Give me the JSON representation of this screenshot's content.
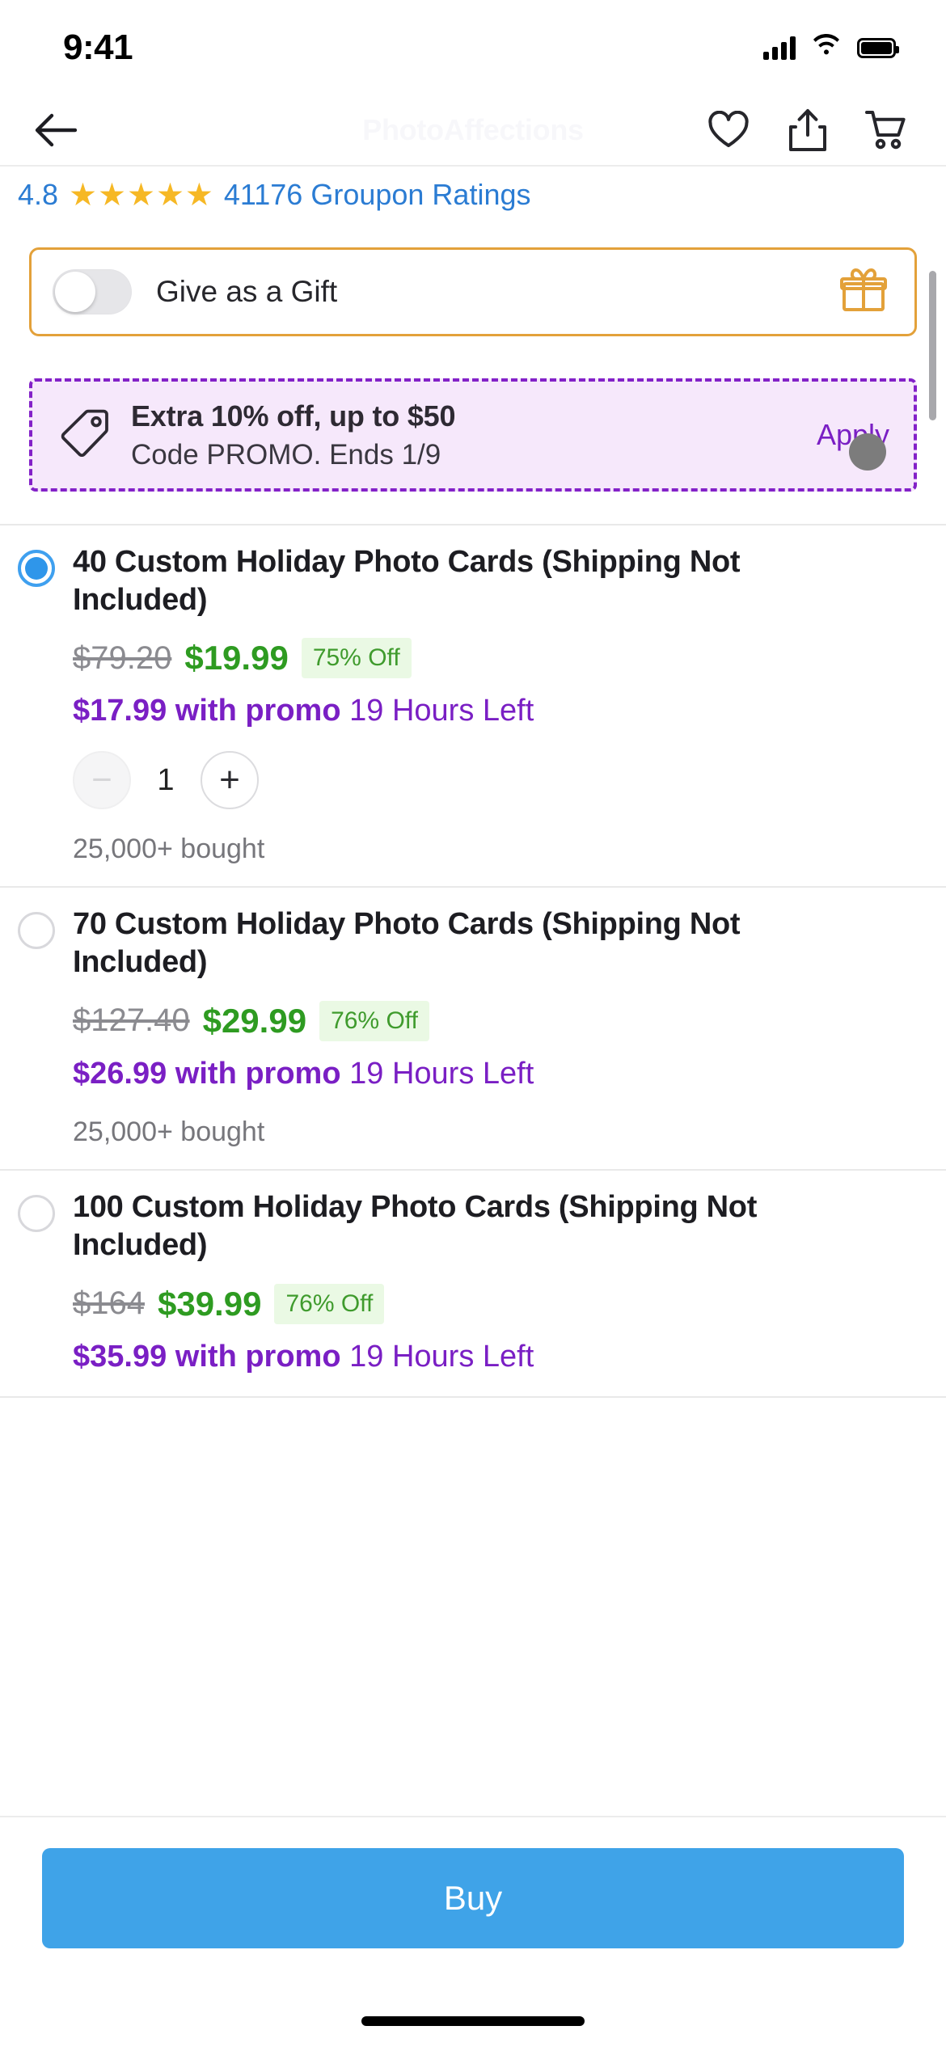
{
  "status_bar": {
    "time": "9:41",
    "signal_icon": "cellular-signal-icon",
    "wifi_icon": "wifi-icon",
    "battery_icon": "battery-icon"
  },
  "header": {
    "back_icon": "back-arrow-icon",
    "merchant_title": "PhotoAffections",
    "wishlist_icon": "heart-icon",
    "share_icon": "share-icon",
    "cart_icon": "cart-icon"
  },
  "ratings": {
    "score": "4.8",
    "stars": 5,
    "star_glyph": "★",
    "count_label": "41176 Groupon Ratings",
    "link_color": "#2b7cd3",
    "star_color": "#f6b825"
  },
  "gift": {
    "label": "Give as a Gift",
    "toggle_on": false,
    "gift_icon": "gift-box-icon",
    "border_color": "#e3a13a"
  },
  "promo": {
    "tag_icon": "price-tag-icon",
    "title": "Extra 10% off, up to $50",
    "subtitle": "Code PROMO. Ends 1/9",
    "apply_label": "Apply",
    "accent_color": "#7a1fc4",
    "background_color": "#f6e8fb"
  },
  "options": [
    {
      "selected": true,
      "title": "40 Custom Holiday Photo Cards (Shipping Not Included)",
      "price_old": "$79.20",
      "price_new": "$19.99",
      "discount_badge": "75% Off",
      "promo_price": "$17.99",
      "promo_suffix": "with promo",
      "time_left": "19 Hours Left",
      "quantity": "1",
      "minus_label": "−",
      "plus_label": "+",
      "bought": "25,000+ bought"
    },
    {
      "selected": false,
      "title": "70 Custom Holiday Photo Cards (Shipping Not Included)",
      "price_old": "$127.40",
      "price_new": "$29.99",
      "discount_badge": "76% Off",
      "promo_price": "$26.99",
      "promo_suffix": "with promo",
      "time_left": "19 Hours Left",
      "bought": "25,000+ bought"
    },
    {
      "selected": false,
      "title": "100 Custom Holiday Photo Cards (Shipping Not Included)",
      "price_old": "$164",
      "price_new": "$39.99",
      "discount_badge": "76% Off",
      "promo_price": "$35.99",
      "promo_suffix": "with promo",
      "time_left": "19 Hours Left"
    }
  ],
  "footer": {
    "buy_label": "Buy",
    "buy_color": "#3fa3e8"
  }
}
